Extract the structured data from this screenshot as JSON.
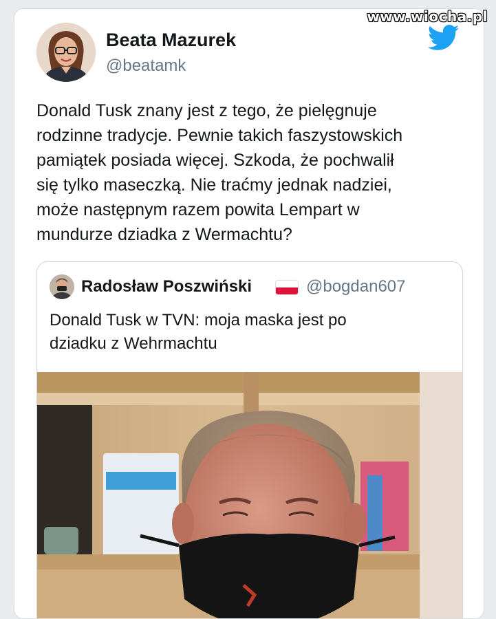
{
  "watermark": "www.wiocha.pl",
  "tweet": {
    "author_name": "Beata Mazurek",
    "author_handle": "@beatamk",
    "text_lines": [
      "Donald Tusk znany jest z tego, że pielęgnuje",
      "rodzinne tradycje. Pewnie takich faszystowskich",
      "pamiątek posiada więcej. Szkoda, że pochwalił",
      "się tylko maseczką. Nie traćmy jednak nadziei,",
      "może następnym razem powita Lempart w",
      "mundurze dziadka z Wermachtu?"
    ]
  },
  "quoted_tweet": {
    "author_name": "Radosław Poszwiński",
    "author_handle": "@bogdan607",
    "text_lines": [
      "Donald Tusk w TVN: moja maska jest po",
      "dziadku z Wehrmachtu"
    ]
  },
  "colors": {
    "twitter_blue": "#1da1f2",
    "text": "#14171a",
    "secondary_text": "#657786"
  },
  "icons": {
    "platform": "twitter-bird-icon",
    "flag": "poland-flag-icon"
  }
}
